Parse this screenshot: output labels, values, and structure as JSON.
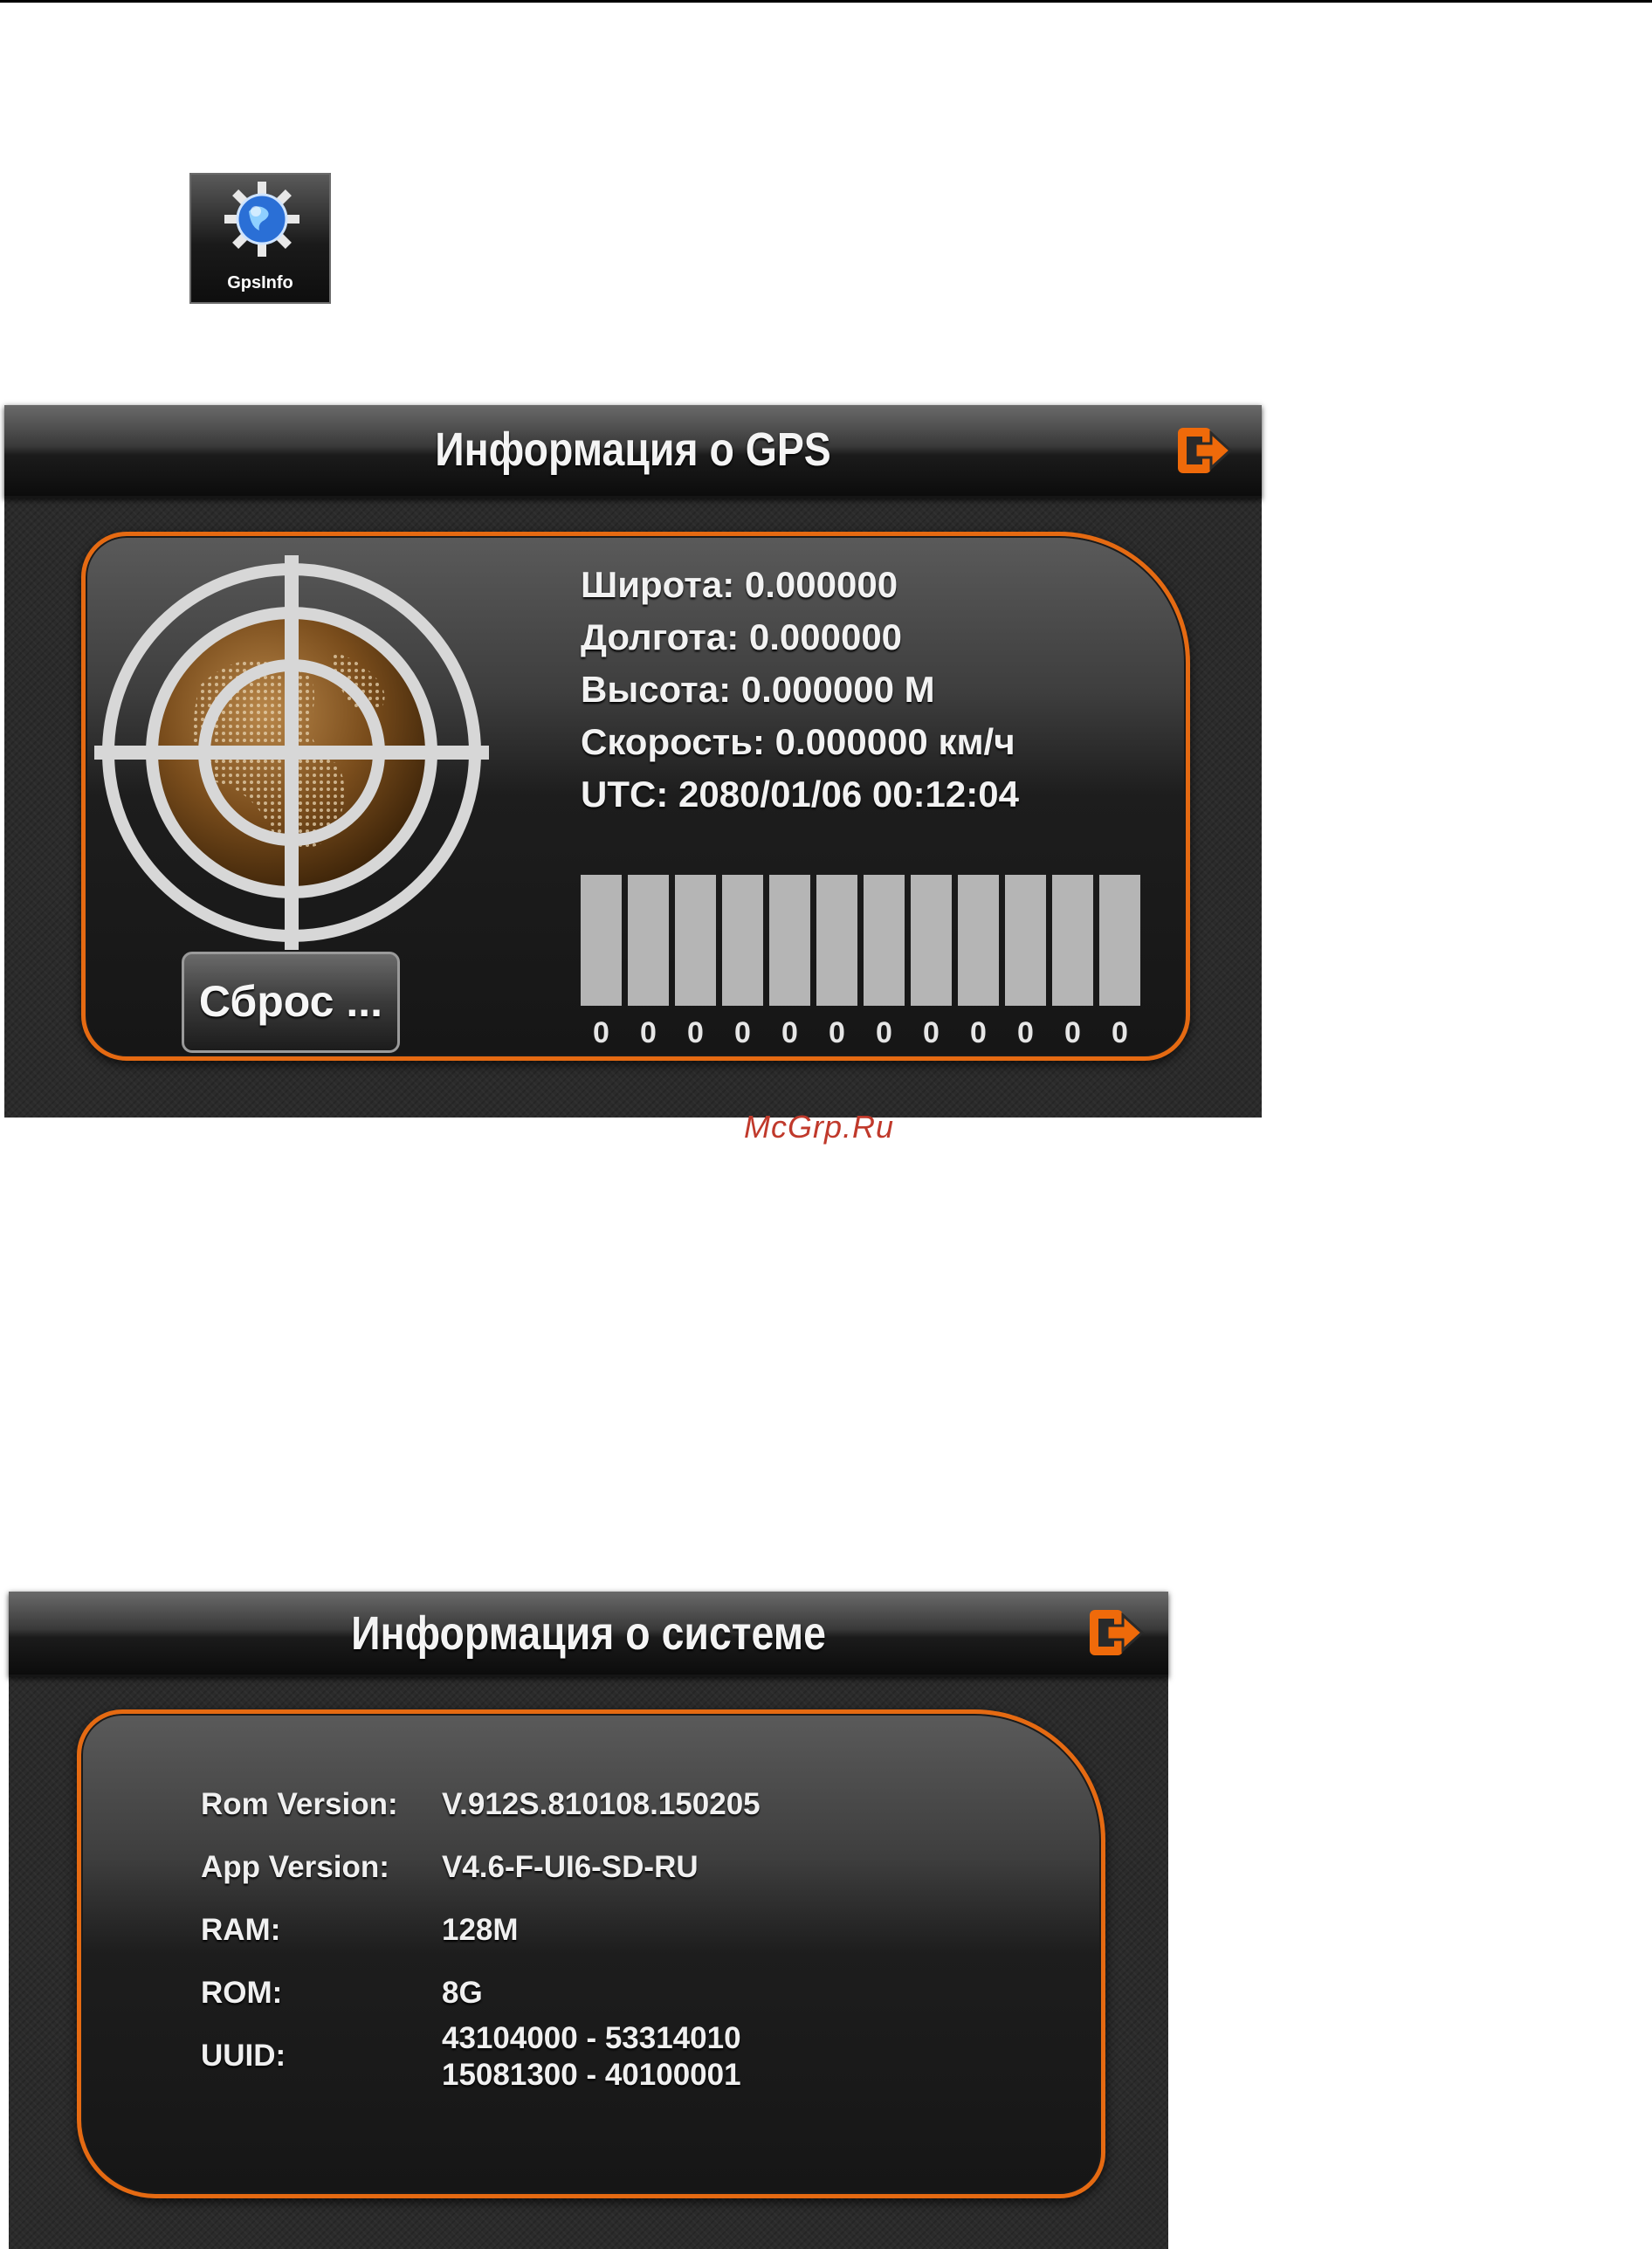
{
  "app_icon": {
    "label": "GpsInfo",
    "icon": "globe-gear-icon"
  },
  "gps_screen": {
    "title": "Информация о GPS",
    "exit_icon": "exit-icon",
    "accent_color": "#e56a12",
    "lines": [
      "Широта: 0.000000",
      "Долгота: 0.000000",
      "Высота: 0.000000 М",
      "Скорость: 0.000000 км/ч",
      "UTC: 2080/01/06 00:12:04"
    ],
    "reset_label": "Сброс ...",
    "satellite_signals": [
      0,
      0,
      0,
      0,
      0,
      0,
      0,
      0,
      0,
      0,
      0,
      0
    ],
    "satellite_labels": [
      "0",
      "0",
      "0",
      "0",
      "0",
      "0",
      "0",
      "0",
      "0",
      "0",
      "0",
      "0"
    ]
  },
  "watermark": "McGrp.Ru",
  "system_screen": {
    "title": "Информация о системе",
    "exit_icon": "exit-icon",
    "rows": [
      {
        "label": "Rom Version:",
        "value": "V.912S.810108.150205"
      },
      {
        "label": "App Version:",
        "value": "V4.6-F-UI6-SD-RU"
      },
      {
        "label": "RAM:",
        "value": "128M"
      },
      {
        "label": "ROM:",
        "value": "8G"
      },
      {
        "label": "UUID:",
        "value": "43104000 - 53314010",
        "value2": "15081300 - 40100001"
      }
    ]
  }
}
